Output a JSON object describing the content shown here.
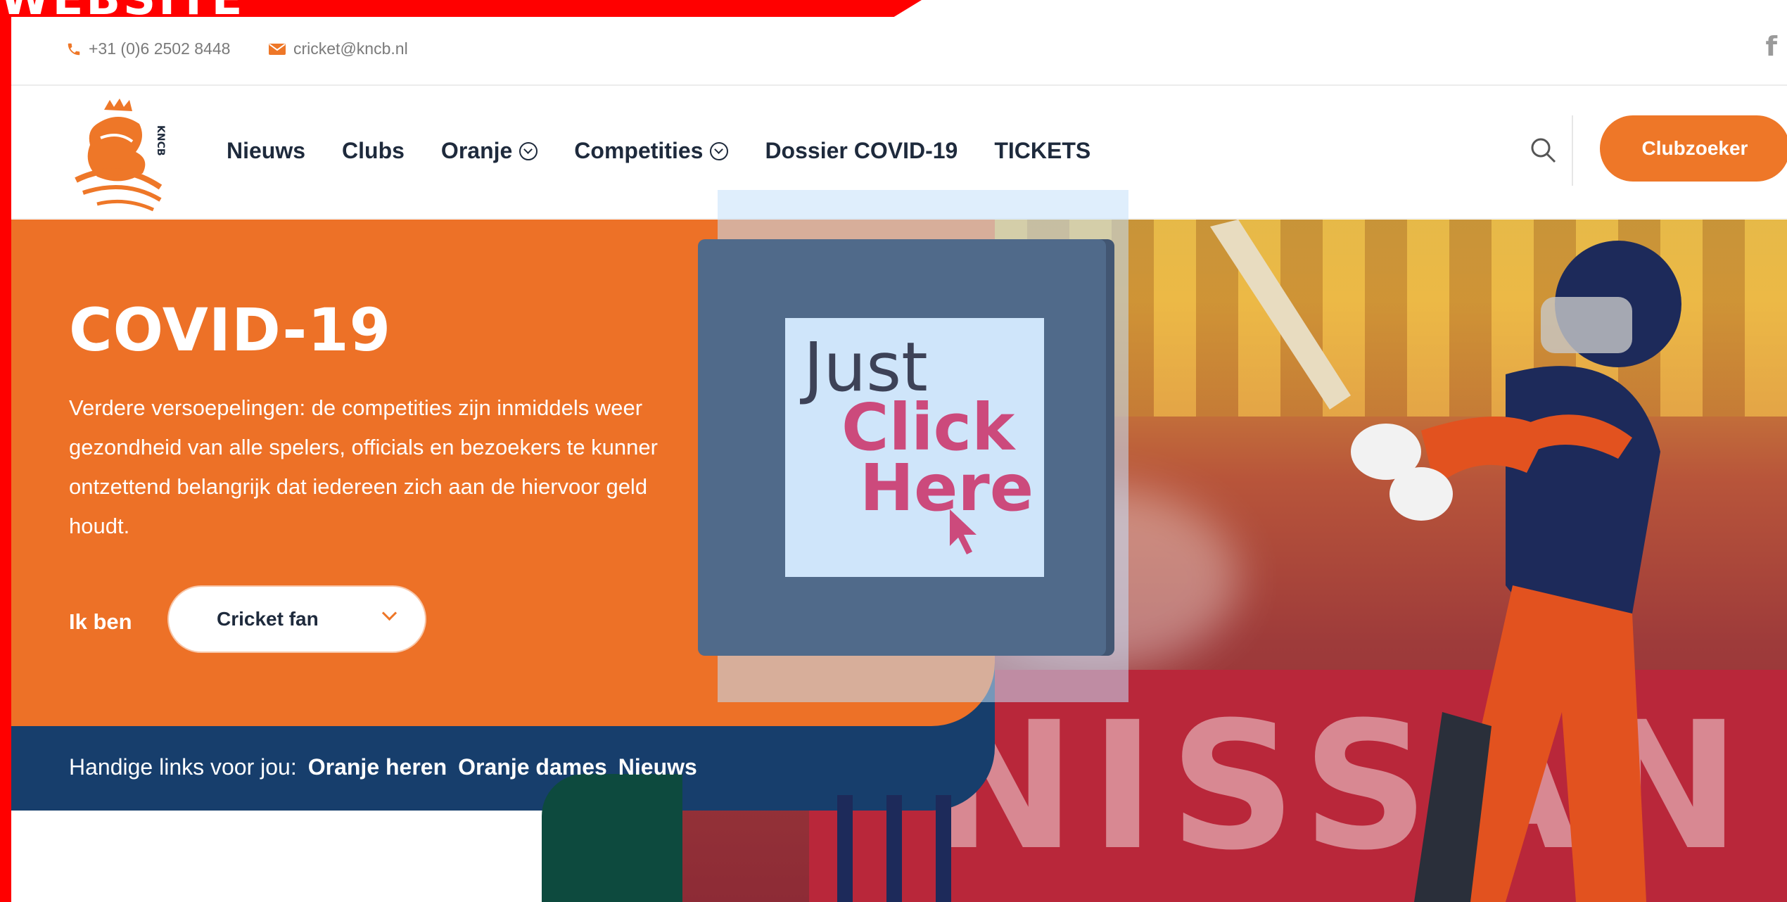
{
  "banner": {
    "text": "WEBSITE"
  },
  "contact": {
    "phone": "+31 (0)6 2502 8448",
    "email": "cricket@kncb.nl"
  },
  "logo": {
    "text": "KNCB"
  },
  "nav": {
    "items": [
      {
        "label": "Nieuws",
        "dropdown": false
      },
      {
        "label": "Clubs",
        "dropdown": false
      },
      {
        "label": "Oranje",
        "dropdown": true
      },
      {
        "label": "Competities",
        "dropdown": true
      },
      {
        "label": "Dossier COVID-19",
        "dropdown": false
      },
      {
        "label": "TICKETS",
        "dropdown": false
      }
    ],
    "cta_label": "Clubzoeker"
  },
  "hero": {
    "title": "COVID-19",
    "text_lines": [
      "Verdere versoepelingen: de competities zijn inmiddels weer",
      "gezondheid van alle spelers, officials en bezoekers te kunner",
      "ontzettend belangrijk dat iedereen zich aan de hiervoor geld",
      "houdt."
    ],
    "ik_ben_label": "Ik ben",
    "role_selected": "Cricket fan"
  },
  "quick_links": {
    "label": "Handige links voor jou:",
    "links": [
      "Oranje heren",
      "Oranje dames",
      "Nieuws"
    ]
  },
  "photo": {
    "hoarding_text": "NISSAN"
  },
  "overlay": {
    "line1": "Just",
    "line2": "Click",
    "line3": "Here"
  },
  "colors": {
    "accent_orange": "#ed7127",
    "navy": "#173e6c",
    "frame_red": "#ff0000",
    "overlay_pink": "#cc4a7c"
  }
}
